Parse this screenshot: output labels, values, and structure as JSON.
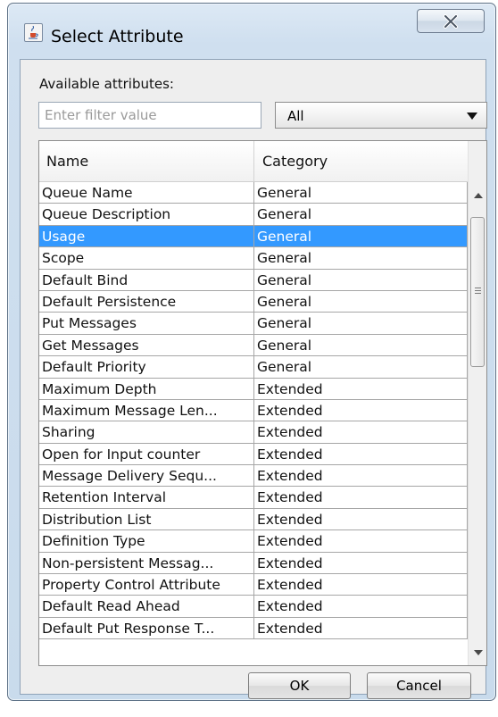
{
  "window": {
    "title": "Select Attribute"
  },
  "content": {
    "available_label": "Available attributes:",
    "filter": {
      "value": "",
      "placeholder": "Enter filter value"
    },
    "category_filter": {
      "selected": "All"
    }
  },
  "table": {
    "columns": [
      "Name",
      "Category"
    ],
    "selected_row": 2,
    "rows": [
      {
        "name": "Queue Name",
        "category": "General"
      },
      {
        "name": "Queue Description",
        "category": "General"
      },
      {
        "name": "Usage",
        "category": "General"
      },
      {
        "name": "Scope",
        "category": "General"
      },
      {
        "name": "Default Bind",
        "category": "General"
      },
      {
        "name": "Default Persistence",
        "category": "General"
      },
      {
        "name": "Put Messages",
        "category": "General"
      },
      {
        "name": "Get Messages",
        "category": "General"
      },
      {
        "name": "Default Priority",
        "category": "General"
      },
      {
        "name": "Maximum Depth",
        "category": "Extended"
      },
      {
        "name": "Maximum Message Len...",
        "category": "Extended"
      },
      {
        "name": "Sharing",
        "category": "Extended"
      },
      {
        "name": "Open for Input counter",
        "category": "Extended"
      },
      {
        "name": "Message Delivery Sequ...",
        "category": "Extended"
      },
      {
        "name": "Retention Interval",
        "category": "Extended"
      },
      {
        "name": "Distribution List",
        "category": "Extended"
      },
      {
        "name": "Definition Type",
        "category": "Extended"
      },
      {
        "name": "Non-persistent Messag...",
        "category": "Extended"
      },
      {
        "name": "Property Control Attribute",
        "category": "Extended"
      },
      {
        "name": "Default Read Ahead",
        "category": "Extended"
      },
      {
        "name": "Default Put Response T...",
        "category": "Extended"
      }
    ]
  },
  "buttons": {
    "ok": "OK",
    "cancel": "Cancel"
  },
  "colors": {
    "selection": "#3399ff",
    "window_frame": "#c9dbec"
  },
  "icons": {
    "app": "java-cup-icon",
    "close": "close-x-icon"
  }
}
